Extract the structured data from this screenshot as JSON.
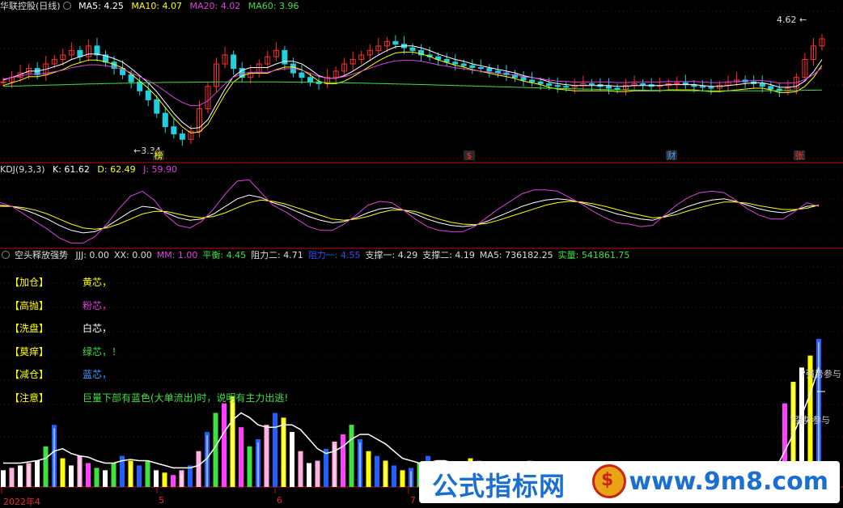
{
  "main_panel": {
    "stock_label": "华联控股(日线)",
    "ma": [
      {
        "label": "MA5:",
        "value": "4.25",
        "color": "#ffffff"
      },
      {
        "label": "MA10:",
        "value": "4.07",
        "color": "#ffff00"
      },
      {
        "label": "MA20:",
        "value": "4.02",
        "color": "#e040e0"
      },
      {
        "label": "MA60:",
        "value": "3.96",
        "color": "#40e040"
      }
    ],
    "high_marker": "4.62",
    "low_marker": "3.34",
    "event_marks": [
      {
        "text": "榜",
        "color": "#ffff00"
      },
      {
        "text": "$",
        "color": "#ff3030"
      },
      {
        "text": "财",
        "color": "#40a0ff"
      },
      {
        "text": "张",
        "color": "#ff3030"
      }
    ]
  },
  "kdj_panel": {
    "name": "KDJ(9,3,3)",
    "k": "K: 61.62",
    "d": "D: 62.49",
    "j": "J: 59.90"
  },
  "indicator_panel": {
    "name": "空头释放强势",
    "values": [
      {
        "text": "JJJ: 0.00",
        "color": "#dddddd"
      },
      {
        "text": "XX: 0.00",
        "color": "#dddddd"
      },
      {
        "text": "MM: 1.00",
        "color": "#e040e0"
      },
      {
        "text": "平衡: 4.45",
        "color": "#40e040"
      },
      {
        "text": "阻力二: 4.71",
        "color": "#dddddd"
      },
      {
        "text": "阻力一: 4.55",
        "color": "#3050ff"
      },
      {
        "text": "支撑一: 4.29",
        "color": "#dddddd"
      },
      {
        "text": "支撑二: 4.19",
        "color": "#dddddd"
      },
      {
        "text": "MA5: 736182.25",
        "color": "#dddddd"
      },
      {
        "text": "实量: 541861.75",
        "color": "#40e040"
      }
    ],
    "notes": [
      {
        "tag": "【加仓】",
        "text": "黄芯，",
        "color": "#ffff00"
      },
      {
        "tag": "【高抛】",
        "text": "粉芯，",
        "color": "#e040e0"
      },
      {
        "tag": "【洗盘】",
        "text": "白芯，",
        "color": "#ffffff"
      },
      {
        "tag": "【莫痒】",
        "text": "绿芯，！",
        "color": "#40e040"
      },
      {
        "tag": "【减仓】",
        "text": "蓝芯，",
        "color": "#40a0ff"
      },
      {
        "tag": "【注意】",
        "text": "巨量下部有蓝色(大单流出)时，说明有主力出逃!",
        "color": "#40e040"
      }
    ],
    "labels_right": [
      "?强势参与",
      "?强势参与"
    ]
  },
  "x_axis": [
    "2022年4",
    "5",
    "6",
    "7"
  ],
  "watermark": {
    "text": "公式指标网",
    "url": "www.9m8.com"
  },
  "chart_data": [
    {
      "type": "candlestick",
      "title": "华联控股(日线)",
      "series_names": [
        "MA5",
        "MA10",
        "MA20",
        "MA60"
      ],
      "annotations": {
        "high": 4.62,
        "low": 3.34
      },
      "close": [
        4.0,
        4.05,
        4.1,
        4.15,
        4.08,
        4.2,
        4.25,
        4.3,
        4.35,
        4.28,
        4.4,
        4.3,
        4.22,
        4.15,
        4.08,
        4.0,
        3.9,
        3.8,
        3.65,
        3.5,
        3.42,
        3.36,
        3.45,
        3.7,
        3.95,
        4.2,
        4.3,
        4.15,
        4.05,
        4.1,
        4.2,
        4.28,
        4.35,
        4.2,
        4.1,
        4.05,
        4.0,
        3.98,
        4.05,
        4.12,
        4.2,
        4.25,
        4.3,
        4.35,
        4.4,
        4.45,
        4.42,
        4.38,
        4.35,
        4.3,
        4.28,
        4.25,
        4.22,
        4.2,
        4.18,
        4.16,
        4.15,
        4.12,
        4.1,
        4.08,
        4.05,
        4.02,
        4.0,
        3.98,
        3.96,
        3.95,
        3.94,
        3.96,
        3.98,
        3.97,
        3.95,
        3.93,
        3.92,
        3.96,
        3.98,
        3.97,
        3.95,
        3.96,
        3.98,
        3.99,
        3.97,
        3.95,
        3.94,
        3.93,
        3.96,
        4.0,
        4.02,
        4.0,
        3.98,
        3.95,
        3.92,
        3.9,
        3.93,
        4.05,
        4.25,
        4.4,
        4.48
      ],
      "ma5": [
        4.02,
        4.05,
        4.08,
        4.12,
        4.12,
        4.14,
        4.17,
        4.2,
        4.25,
        4.28,
        4.31,
        4.31,
        4.29,
        4.26,
        4.22,
        4.15,
        4.07,
        3.99,
        3.89,
        3.77,
        3.65,
        3.55,
        3.48,
        3.49,
        3.58,
        3.75,
        3.92,
        4.06,
        4.13,
        4.16,
        4.16,
        4.16,
        4.2,
        4.23,
        4.23,
        4.2,
        4.14,
        4.07,
        4.04,
        4.04,
        4.07,
        4.12,
        4.18,
        4.24,
        4.3,
        4.35,
        4.39,
        4.4,
        4.4,
        4.38,
        4.35,
        4.31,
        4.28,
        4.25,
        4.23,
        4.2,
        4.18,
        4.16,
        4.14,
        4.12,
        4.1,
        4.07,
        4.05,
        4.03,
        4.0,
        3.98,
        3.97,
        3.96,
        3.96,
        3.96,
        3.96,
        3.96,
        3.95,
        3.95,
        3.96,
        3.96,
        3.96,
        3.96,
        3.97,
        3.97,
        3.97,
        3.97,
        3.96,
        3.95,
        3.95,
        3.96,
        3.97,
        3.98,
        3.99,
        3.99,
        3.97,
        3.94,
        3.94,
        3.95,
        4.01,
        4.11,
        4.25
      ]
    },
    {
      "type": "line",
      "title": "KDJ(9,3,3)",
      "series": [
        {
          "name": "K",
          "values": [
            62,
            60,
            55,
            48,
            40,
            30,
            22,
            18,
            20,
            28,
            40,
            52,
            60,
            58,
            50,
            42,
            38,
            40,
            48,
            60,
            72,
            78,
            74,
            66,
            60,
            52,
            44,
            38,
            34,
            36,
            42,
            50,
            56,
            58,
            54,
            48,
            40,
            34,
            30,
            28,
            30,
            36,
            44,
            52,
            60,
            66,
            70,
            72,
            70,
            66,
            60,
            54,
            48,
            44,
            40,
            38,
            44,
            52,
            60,
            66,
            70,
            72,
            68,
            62,
            56,
            52,
            50,
            54,
            60,
            62
          ]
        },
        {
          "name": "D",
          "values": [
            60,
            60,
            58,
            54,
            48,
            40,
            32,
            26,
            24,
            26,
            32,
            40,
            48,
            52,
            52,
            48,
            44,
            42,
            44,
            50,
            58,
            66,
            70,
            68,
            64,
            58,
            52,
            46,
            40,
            38,
            40,
            44,
            50,
            54,
            54,
            52,
            46,
            40,
            35,
            32,
            31,
            33,
            38,
            44,
            50,
            56,
            62,
            66,
            68,
            67,
            64,
            60,
            55,
            50,
            46,
            42,
            43,
            47,
            53,
            58,
            63,
            67,
            67,
            65,
            61,
            58,
            55,
            55,
            57,
            62
          ]
        },
        {
          "name": "J",
          "values": [
            66,
            60,
            48,
            36,
            24,
            10,
            2,
            2,
            12,
            32,
            56,
            76,
            84,
            70,
            46,
            30,
            26,
            36,
            56,
            80,
            100,
            102,
            82,
            62,
            52,
            40,
            28,
            22,
            22,
            32,
            46,
            62,
            68,
            66,
            54,
            40,
            28,
            22,
            20,
            20,
            28,
            42,
            56,
            68,
            80,
            86,
            86,
            84,
            74,
            64,
            52,
            42,
            34,
            32,
            28,
            30,
            46,
            62,
            74,
            82,
            84,
            82,
            70,
            56,
            46,
            40,
            40,
            52,
            66,
            60
          ]
        }
      ]
    },
    {
      "type": "bar",
      "title": "空头释放强势",
      "series_names": [
        "volume",
        "MA5"
      ],
      "values": [
        14,
        16,
        18,
        20,
        22,
        34,
        52,
        24,
        18,
        26,
        20,
        16,
        14,
        20,
        26,
        22,
        18,
        22,
        14,
        12,
        10,
        14,
        18,
        30,
        46,
        62,
        70,
        76,
        50,
        34,
        40,
        52,
        62,
        58,
        46,
        30,
        20,
        22,
        32,
        38,
        44,
        52,
        40,
        30,
        26,
        22,
        18,
        14,
        16,
        20,
        26,
        22,
        18,
        16,
        20,
        24,
        22,
        18,
        14,
        16,
        18,
        20,
        22,
        18,
        16,
        14,
        14,
        16,
        18,
        16,
        14,
        12,
        14,
        16,
        18,
        16,
        14,
        14,
        16,
        18,
        16,
        14,
        12,
        14,
        16,
        18,
        16,
        14,
        12,
        14,
        16,
        18,
        70,
        88,
        100,
        110,
        124
      ],
      "ma5": [
        20,
        20,
        20,
        21,
        22,
        24,
        30,
        32,
        28,
        26,
        25,
        22,
        20,
        20,
        22,
        23,
        22,
        22,
        20,
        18,
        16,
        16,
        16,
        18,
        24,
        34,
        46,
        56,
        62,
        58,
        52,
        50,
        50,
        52,
        52,
        48,
        40,
        32,
        28,
        30,
        34,
        40,
        44,
        44,
        40,
        36,
        30,
        24,
        22,
        20,
        20,
        22,
        22,
        20,
        18,
        18,
        20,
        20,
        18,
        16,
        16,
        16,
        18,
        18,
        18,
        16,
        16,
        16,
        16,
        16,
        16,
        14,
        14,
        14,
        16,
        16,
        16,
        16,
        16,
        16,
        16,
        16,
        14,
        14,
        14,
        16,
        16,
        16,
        14,
        14,
        16,
        16,
        30,
        44,
        60,
        78,
        100
      ]
    }
  ]
}
